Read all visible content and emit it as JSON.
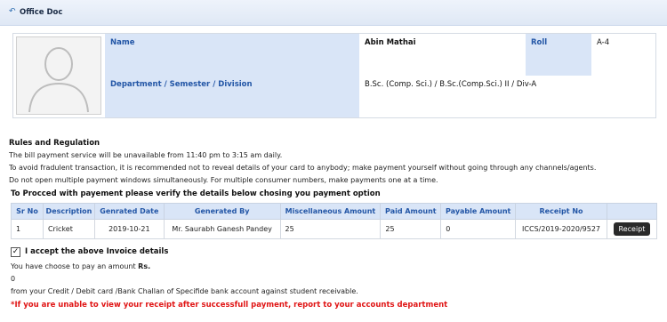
{
  "header": {
    "title": "Office Doc",
    "icon": "back-arrow-icon"
  },
  "profile": {
    "name_label": "Name",
    "name_value": "Abin Mathai",
    "roll_label": "Roll",
    "roll_value": "A-4",
    "dept_label": "Department  /  Semester  /  Division",
    "dept_value": "B.Sc. (Comp. Sci.)  / B.Sc.(Comp.Sci.) II  / Div-A"
  },
  "rules": {
    "heading": "Rules and Regulation",
    "lines": [
      "The bill payment service will be unavailable from 11:40 pm to 3:15 am daily.",
      "To avoid fradulent transaction, it is recommended not to reveal details of your card to anybody; make payment yourself without going through any channels/agents.",
      "Do not open multiple payment windows simultaneously. For multiple consumer numbers, make payments one at a time."
    ]
  },
  "procced_text": "To Procced with payement please verify the details below chosing you payment option",
  "table": {
    "headers": [
      "Sr No",
      "Description",
      "Genrated Date",
      "Generated By",
      "Miscellaneous Amount",
      "Paid Amount",
      "Payable Amount",
      "Receipt No",
      ""
    ],
    "rows": [
      {
        "sr": "1",
        "desc": "Cricket",
        "date": "2019-10-21",
        "by": "Mr. Saurabh Ganesh Pandey",
        "misc": "25",
        "paid": "25",
        "payable": "0",
        "receipt_no": "ICCS/2019-2020/9527",
        "button": "Receipt"
      }
    ]
  },
  "accept": {
    "label": "I accept the above Invoice details",
    "checked": true
  },
  "amount_text": "You have choose to pay an amount",
  "currency": "Rs.",
  "amount_value": "0",
  "source_text": "from your Credit / Debit card /Bank Challan of Specifide bank account against student receivable.",
  "warning": "*If you are unable to view your receipt after successfull payment, report to your accounts department",
  "colors": {
    "label_bg": "#d9e5f7",
    "label_text": "#2356a6",
    "warning": "#e01515"
  }
}
